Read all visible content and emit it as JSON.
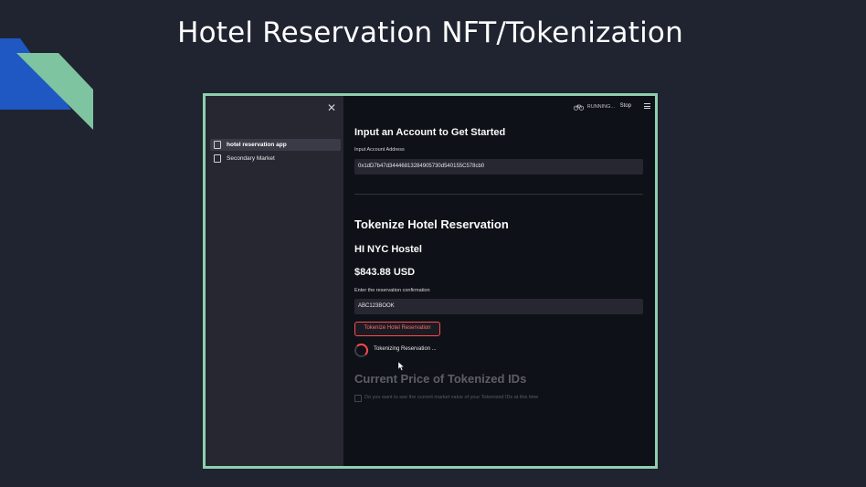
{
  "slide": {
    "title": "Hotel Reservation NFT/Tokenization"
  },
  "colors": {
    "background": "#1f2430",
    "frame_border": "#8fcfae",
    "deco_blue": "#1f57c3",
    "deco_green": "#7fc4a0",
    "accent_red": "#ff4b4b"
  },
  "sidebar": {
    "close_icon": "close-icon",
    "items": [
      {
        "label": "hotel reservation app",
        "icon": "document-icon",
        "active": true
      },
      {
        "label": "Secondary Market",
        "icon": "document-icon",
        "active": false
      }
    ]
  },
  "topbar": {
    "status": "RUNNING...",
    "status_icon": "bicycle-icon",
    "stop_label": "Stop",
    "menu_icon": "hamburger-menu-icon"
  },
  "main": {
    "section1_heading": "Input an Account to Get Started",
    "account_label": "Input Account Address",
    "account_value": "0x1dD7b47d34446813284905730d540155C578cb0",
    "section2_heading": "Tokenize Hotel Reservation",
    "hotel_name": "HI NYC Hostel",
    "price": "$843.88 USD",
    "confirmation_label": "Enter the reservation confirmation",
    "confirmation_value": "ABC123BOOK",
    "tokenize_button": "Tokenize Hotel Reservation",
    "spinner_text": "Tokenizing Reservation ...",
    "section3_heading": "Current Price of Tokenized IDs",
    "checkbox_label": "Do you want to see the current market value of your Tokenized IDs at this time"
  }
}
